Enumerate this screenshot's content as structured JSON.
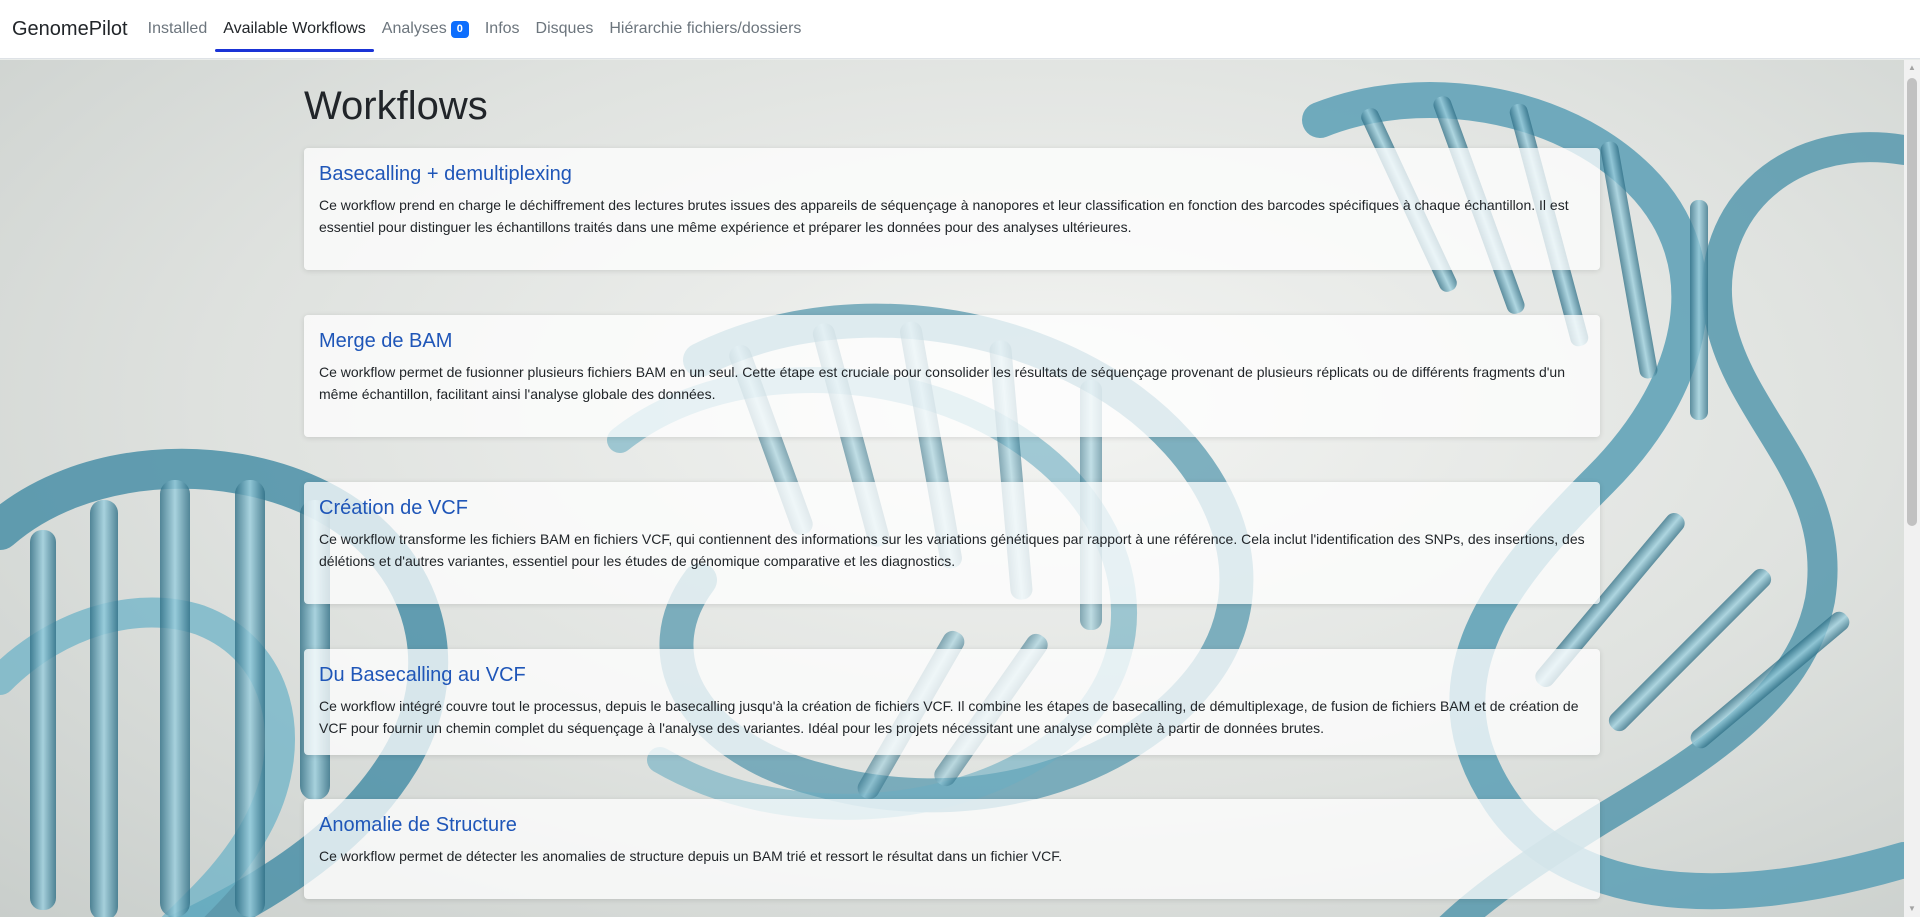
{
  "navbar": {
    "brand": "GenomePilot",
    "links": [
      {
        "label": "Installed"
      },
      {
        "label": "Available Workflows"
      },
      {
        "label": "Analyses"
      },
      {
        "label": "Infos"
      },
      {
        "label": "Disques"
      },
      {
        "label": "Hiérarchie fichiers/dossiers"
      }
    ],
    "analyses_badge": "0"
  },
  "page": {
    "title": "Workflows"
  },
  "workflows": [
    {
      "title": "Basecalling + demultiplexing",
      "description": "Ce workflow prend en charge le déchiffrement des lectures brutes issues des appareils de séquençage à nanopores et leur classification en fonction des barcodes spécifiques à chaque échantillon. Il est essentiel pour distinguer les échantillons traités dans une même expérience et préparer les données pour des analyses ultérieures."
    },
    {
      "title": "Merge de BAM",
      "description": "Ce workflow permet de fusionner plusieurs fichiers BAM en un seul. Cette étape est cruciale pour consolider les résultats de séquençage provenant de plusieurs réplicats ou de différents fragments d'un même échantillon, facilitant ainsi l'analyse globale des données."
    },
    {
      "title": "Création de VCF",
      "description": "Ce workflow transforme les fichiers BAM en fichiers VCF, qui contiennent des informations sur les variations génétiques par rapport à une référence. Cela inclut l'identification des SNPs, des insertions, des délétions et d'autres variantes, essentiel pour les études de génomique comparative et les diagnostics."
    },
    {
      "title": "Du Basecalling au VCF",
      "description": "Ce workflow intégré couvre tout le processus, depuis le basecalling jusqu'à la création de fichiers VCF. Il combine les étapes de basecalling, de démultiplexage, de fusion de fichiers BAM et de création de VCF pour fournir un chemin complet du séquençage à l'analyse des variantes. Idéal pour les projets nécessitant une analyse complète à partir de données brutes."
    },
    {
      "title": "Anomalie de Structure",
      "description": "Ce workflow permet de détecter les anomalies de structure depuis un BAM trié et ressort le résultat dans un fichier VCF."
    }
  ],
  "colors": {
    "accent_underline": "#1a33d6",
    "badge": "#0d6efd",
    "card_title": "#1f56b8",
    "dna_strand": "#5a9fb5"
  },
  "icons": {
    "scroll_up": "triangle-up",
    "scroll_down": "triangle-down"
  }
}
